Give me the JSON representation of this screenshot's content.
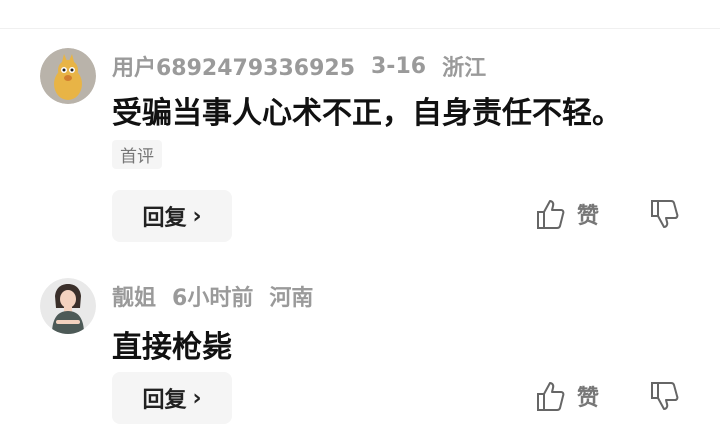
{
  "comments": [
    {
      "user": "用户6892479336925",
      "time": "3-16",
      "location": "浙江",
      "text": "受骗当事人心术不正，自身责任不轻。",
      "tag": "首评",
      "reply_label": "回复",
      "like_label": "赞"
    },
    {
      "user": "靓姐",
      "time": "6小时前",
      "location": "河南",
      "text": "直接枪毙",
      "reply_label": "回复",
      "like_label": "赞"
    }
  ],
  "icons": {
    "chevron": "›",
    "thumb_up": "thumb-up-icon",
    "thumb_down": "thumb-down-icon"
  }
}
